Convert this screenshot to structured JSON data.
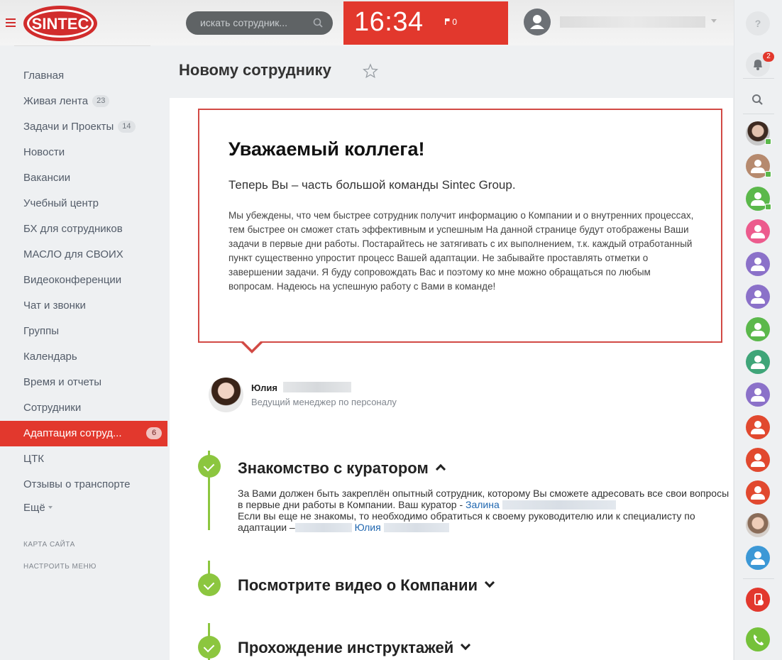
{
  "header": {
    "logo_text": "SINTEC",
    "search_placeholder": "искать сотрудник...",
    "clock_time": "16:34",
    "flag_count": "0"
  },
  "menu": {
    "items": [
      {
        "label": "Главная",
        "count": null
      },
      {
        "label": "Живая лента",
        "count": "23"
      },
      {
        "label": "Задачи и Проекты",
        "count": "14"
      },
      {
        "label": "Новости",
        "count": null
      },
      {
        "label": "Вакансии",
        "count": null
      },
      {
        "label": "Учебный центр",
        "count": null
      },
      {
        "label": "БХ для сотрудников",
        "count": null
      },
      {
        "label": "МАСЛО для СВОИХ",
        "count": null
      },
      {
        "label": "Видеоконференции",
        "count": null
      },
      {
        "label": "Чат и звонки",
        "count": null
      },
      {
        "label": "Группы",
        "count": null
      },
      {
        "label": "Календарь",
        "count": null
      },
      {
        "label": "Время и отчеты",
        "count": null
      },
      {
        "label": "Сотрудники",
        "count": null
      },
      {
        "label": "Адаптация сотруд...",
        "count": "6"
      },
      {
        "label": "ЦТК",
        "count": null
      },
      {
        "label": "Отзывы о транспорте",
        "count": null
      }
    ],
    "more_label": "Ещё",
    "sitemap_label": "КАРТА САЙТА",
    "configure_label": "НАСТРОИТЬ МЕНЮ"
  },
  "page": {
    "title": "Новому сотруднику"
  },
  "welcome": {
    "heading": "Уважаемый коллега!",
    "subheading": "Теперь Вы – часть большой команды Sintec Group.",
    "body": "Мы убеждены, что чем быстрее сотрудник получит информацию о Компании и о внутренних процессах, тем быстрее он сможет стать эффективным и успешным На данной странице будут отображены Ваши задачи в первые дни работы. Постарайтесь не затягивать с их выполнением, т.к. каждый отработанный пункт существенно упростит процесс Вашей адаптации. Не забывайте проставлять отметки о завершении задачи. Я буду сопровождать Вас и поэтому ко мне можно обращаться по любым вопросам. Надеюсь на успешную работу с Вами в команде!"
  },
  "author": {
    "name": "Юлия",
    "role": "Ведущий менеджер по персоналу"
  },
  "steps": [
    {
      "title": "Знакомство с куратором",
      "expanded": true
    },
    {
      "title": "Посмотрите видео о Компании",
      "expanded": false
    },
    {
      "title": "Прохождение инструктажей",
      "expanded": false
    }
  ],
  "step_text": {
    "part1": "За Вами должен быть закреплён опытный сотрудник, которому Вы сможете адресовать все свои вопросы в первые дни работы в Компании. Ваш куратор - ",
    "curator_link": "Залина",
    "part2": "Если вы еще не знакомы, то необходимо обратиться к своему руководителю или к специалисту по адаптации –",
    "specialist_link": "Юлия"
  },
  "rightbar": {
    "help_label": "?",
    "notification_count": "2"
  },
  "colors": {
    "brand_red": "#e2382d",
    "step_green": "#8cc63f",
    "link_blue": "#2067b0"
  }
}
